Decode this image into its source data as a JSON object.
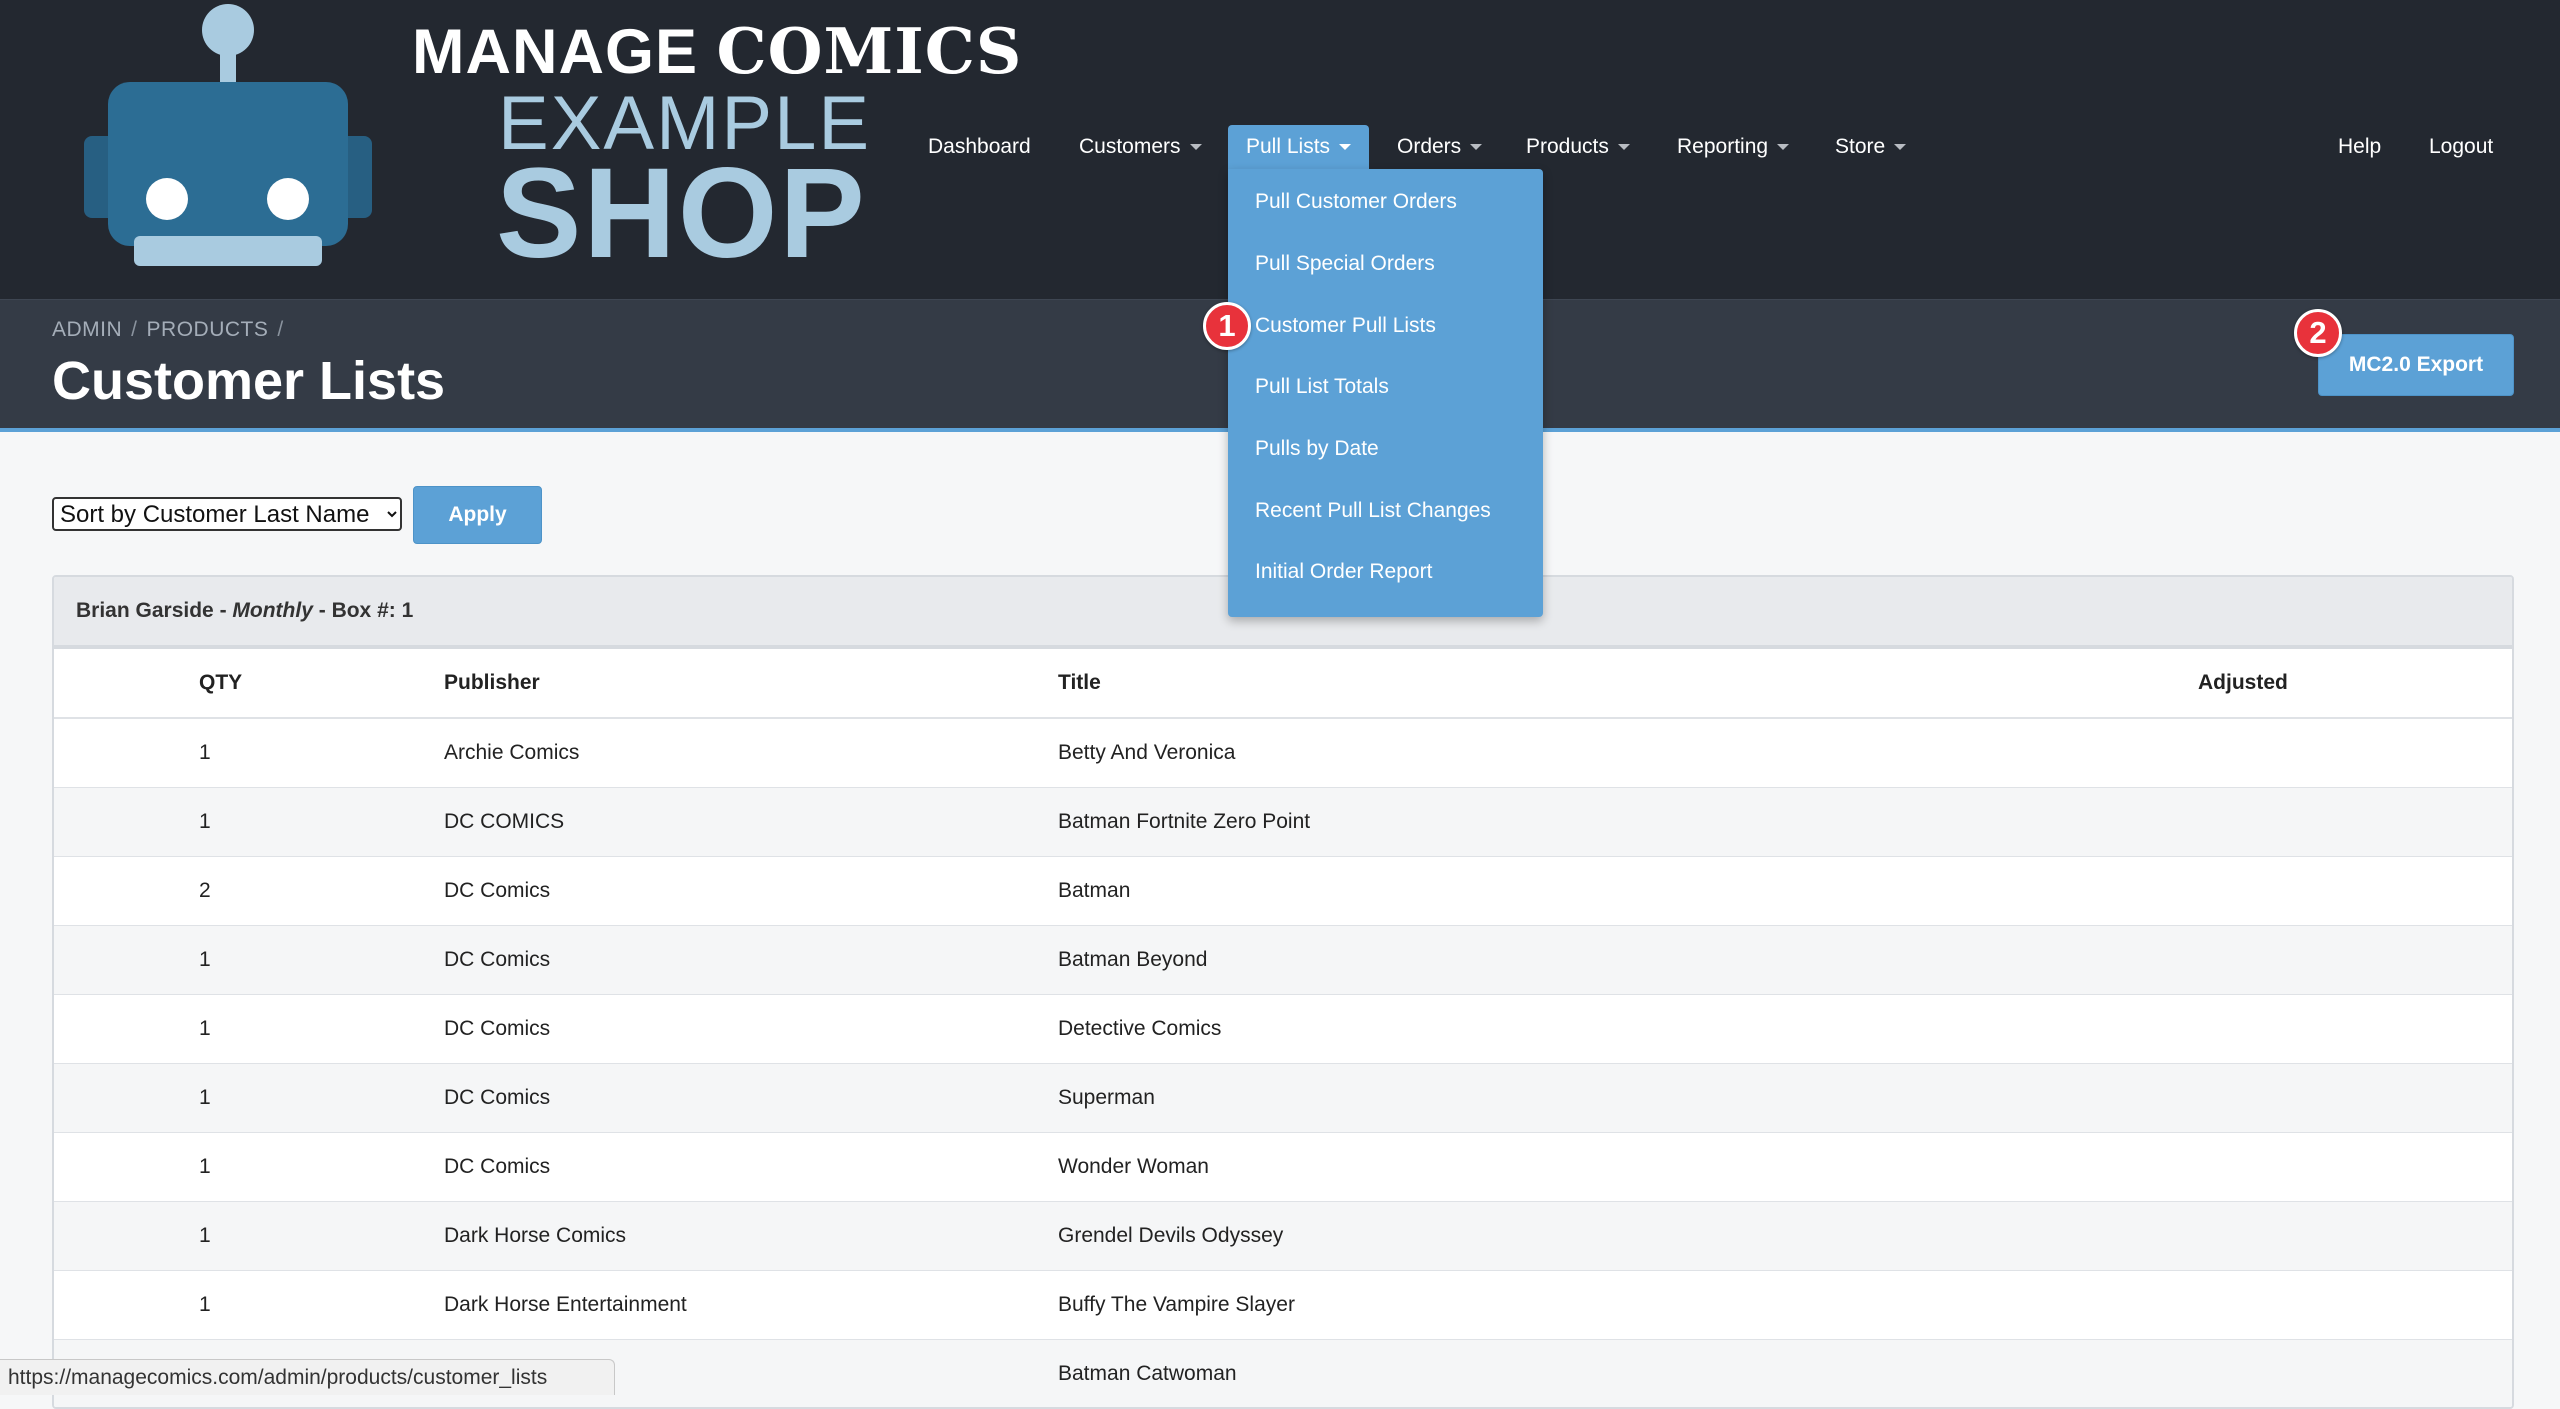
{
  "brand": {
    "line1_a": "MANAGE ",
    "line1_b": "COMICS",
    "line2": "EXAMPLE",
    "line3": "SHOP"
  },
  "nav": {
    "dashboard": "Dashboard",
    "customers": "Customers",
    "pull_lists": "Pull Lists",
    "orders": "Orders",
    "products": "Products",
    "reporting": "Reporting",
    "store": "Store",
    "help": "Help",
    "logout": "Logout"
  },
  "dropdown": {
    "items": [
      "Pull Customer Orders",
      "Pull Special Orders",
      "Customer Pull Lists",
      "Pull List Totals",
      "Pulls by Date",
      "Recent Pull List Changes",
      "Initial Order Report"
    ]
  },
  "breadcrumb": {
    "admin": "ADMIN",
    "products": "PRODUCTS",
    "sep": "/"
  },
  "page": {
    "title": "Customer Lists",
    "export_label": "MC2.0 Export"
  },
  "callouts": {
    "one": "1",
    "two": "2"
  },
  "controls": {
    "sort_options": [
      "Sort by Customer Last Name"
    ],
    "sort_selected": "Sort by Customer Last Name",
    "apply_label": "Apply"
  },
  "customer": {
    "name": "Brian Garside",
    "dash1": " - ",
    "frequency": "Monthly",
    "dash2": " - ",
    "box": "Box #: 1"
  },
  "table": {
    "headers": {
      "qty": "QTY",
      "publisher": "Publisher",
      "title": "Title",
      "adjusted": "Adjusted"
    },
    "rows": [
      {
        "qty": "1",
        "publisher": "Archie Comics",
        "title": "Betty And Veronica",
        "adjusted": ""
      },
      {
        "qty": "1",
        "publisher": "DC COMICS",
        "title": "Batman Fortnite Zero Point",
        "adjusted": ""
      },
      {
        "qty": "2",
        "publisher": "DC Comics",
        "title": "Batman",
        "adjusted": ""
      },
      {
        "qty": "1",
        "publisher": "DC Comics",
        "title": "Batman Beyond",
        "adjusted": ""
      },
      {
        "qty": "1",
        "publisher": "DC Comics",
        "title": "Detective Comics",
        "adjusted": ""
      },
      {
        "qty": "1",
        "publisher": "DC Comics",
        "title": "Superman",
        "adjusted": ""
      },
      {
        "qty": "1",
        "publisher": "DC Comics",
        "title": "Wonder Woman",
        "adjusted": ""
      },
      {
        "qty": "1",
        "publisher": "Dark Horse Comics",
        "title": "Grendel Devils Odyssey",
        "adjusted": ""
      },
      {
        "qty": "1",
        "publisher": "Dark Horse Entertainment",
        "title": "Buffy The Vampire Slayer",
        "adjusted": ""
      },
      {
        "qty": "",
        "publisher": "",
        "title": "Batman Catwoman",
        "adjusted": ""
      }
    ]
  },
  "status": {
    "url": "https://managecomics.com/admin/products/customer_lists"
  },
  "colors": {
    "nav_bg": "#232830",
    "header_bg": "#343b46",
    "accent": "#5ca1d6",
    "callout": "#e8323b",
    "robot": "#2c6d94"
  }
}
